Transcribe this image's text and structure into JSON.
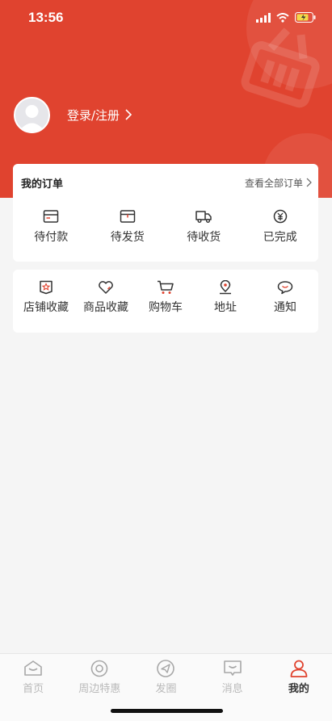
{
  "status_bar": {
    "time": "13:56"
  },
  "colors": {
    "primary": "#e0432f",
    "background": "#f5f5f5",
    "tab_active": "#e0432f",
    "tab_inactive": "#b9b9b9"
  },
  "user": {
    "login_label": "登录/注册",
    "icon": "chevron-right-icon"
  },
  "orders": {
    "title": "我的订单",
    "view_all": "查看全部订单",
    "items": [
      {
        "label": "待付款",
        "icon": "card-icon"
      },
      {
        "label": "待发货",
        "icon": "box-icon"
      },
      {
        "label": "待收货",
        "icon": "truck-icon"
      },
      {
        "label": "已完成",
        "icon": "yen-circle-icon"
      }
    ]
  },
  "tools": {
    "items": [
      {
        "label": "店铺收藏",
        "icon": "store-star-icon"
      },
      {
        "label": "商品收藏",
        "icon": "heart-icon"
      },
      {
        "label": "购物车",
        "icon": "cart-icon"
      },
      {
        "label": "地址",
        "icon": "location-icon"
      },
      {
        "label": "通知",
        "icon": "chat-bubble-icon"
      }
    ]
  },
  "tabbar": {
    "items": [
      {
        "label": "首页",
        "icon": "home-icon",
        "active": false
      },
      {
        "label": "周边特惠",
        "icon": "target-icon",
        "active": false
      },
      {
        "label": "发圈",
        "icon": "send-icon",
        "active": false
      },
      {
        "label": "消息",
        "icon": "message-icon",
        "active": false
      },
      {
        "label": "我的",
        "icon": "person-icon",
        "active": true
      }
    ]
  }
}
